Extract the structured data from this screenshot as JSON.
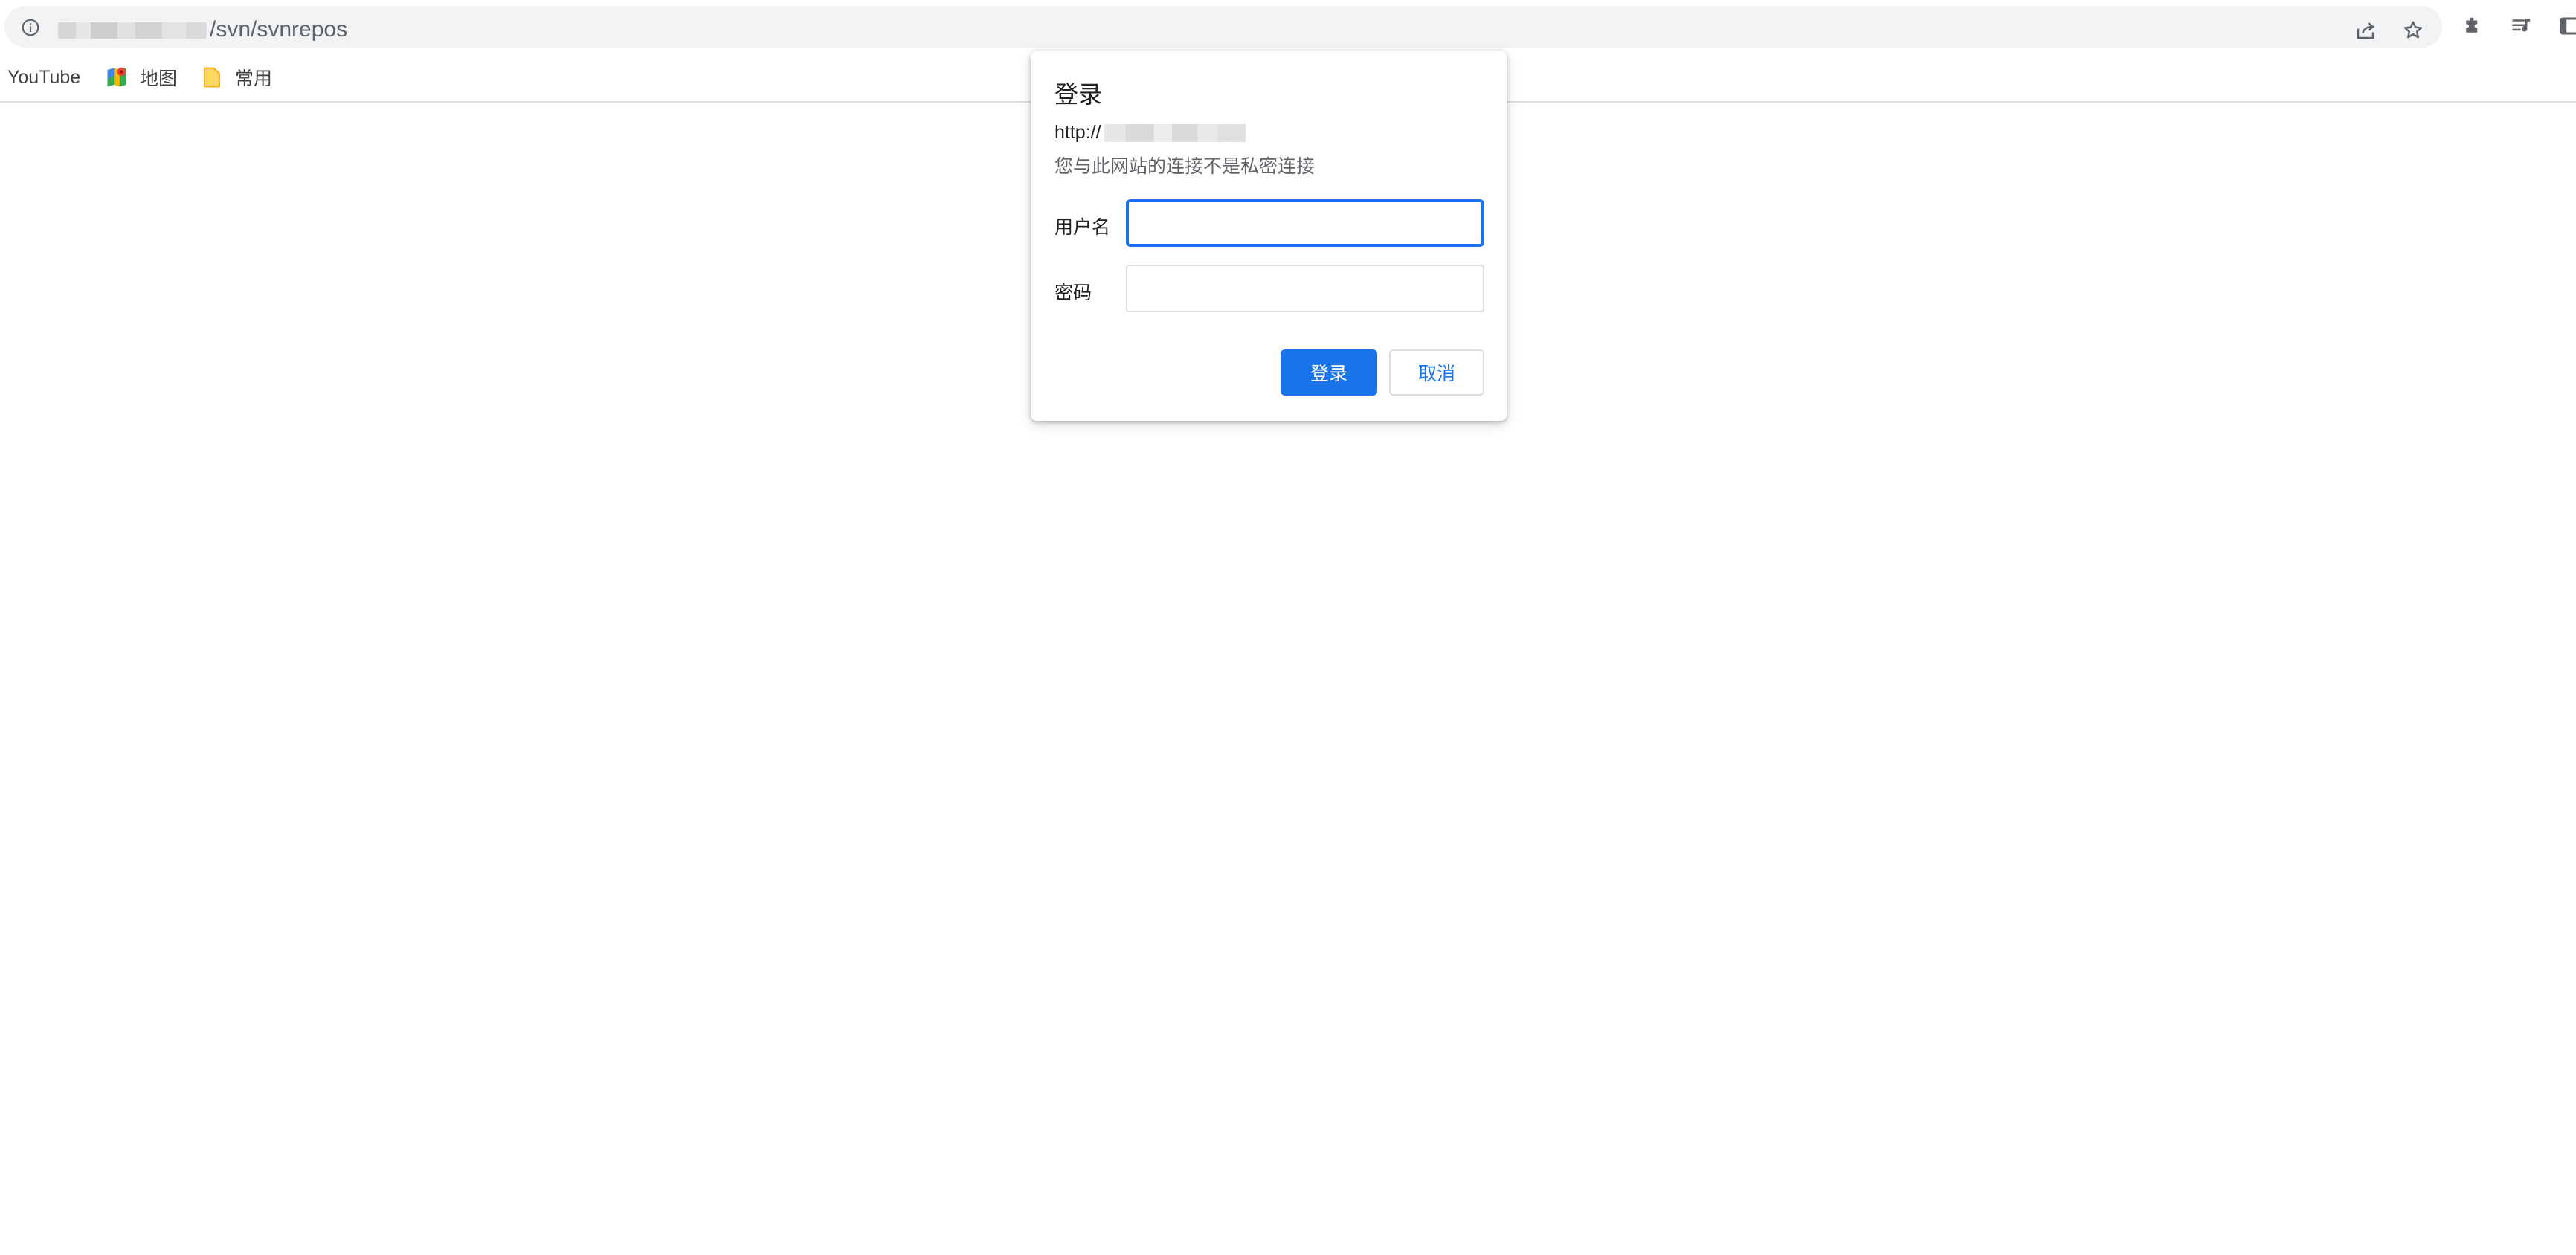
{
  "address_bar": {
    "url_path": "/svn/svnrepos",
    "icons": [
      "info-icon",
      "share-icon",
      "star-icon"
    ]
  },
  "toolbar": {
    "icons": [
      "extensions-icon",
      "reading-list-icon",
      "side-panel-icon"
    ]
  },
  "bookmarks": [
    {
      "label": "YouTube",
      "icon": ""
    },
    {
      "label": "地图",
      "icon": "maps-icon"
    },
    {
      "label": "常用",
      "icon": "folder-icon"
    }
  ],
  "dialog": {
    "title": "登录",
    "origin_prefix": "http://",
    "warning": "您与此网站的连接不是私密连接",
    "username_label": "用户名",
    "username_value": "",
    "password_label": "密码",
    "password_value": "",
    "login_button": "登录",
    "cancel_button": "取消"
  },
  "colors": {
    "accent": "#1a73e8",
    "omnibox_bg": "#f1f3f4",
    "divider": "#dadce0"
  }
}
